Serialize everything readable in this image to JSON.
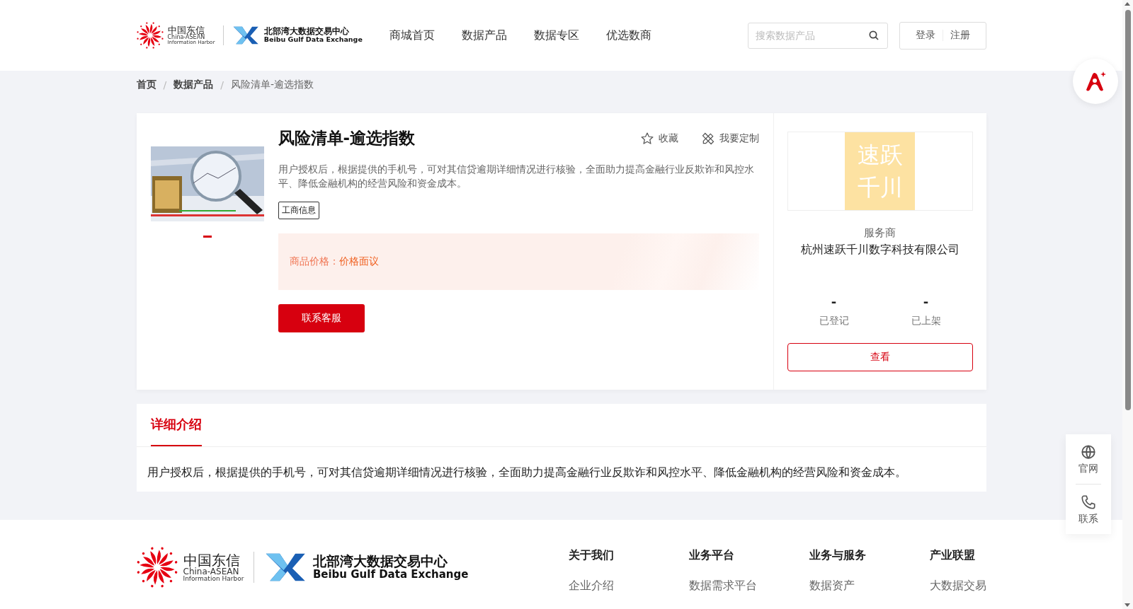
{
  "header": {
    "logo_a": {
      "name": "中国东信",
      "sub1": "China-ASEAN",
      "sub2": "Information Harbor"
    },
    "logo_b": {
      "name": "北部湾大数据交易中心",
      "sub": "Beibu Gulf Data Exchange"
    },
    "nav": [
      {
        "label": "商城首页",
        "selected": false
      },
      {
        "label": "数据产品",
        "selected": false
      },
      {
        "label": "数据专区",
        "selected": false
      },
      {
        "label": "优选数商",
        "selected": false
      }
    ],
    "search": {
      "placeholder": "搜索数据产品"
    },
    "auth": [
      "登录",
      "注册"
    ]
  },
  "breadcrumb": [
    {
      "label": "首页",
      "current": false
    },
    {
      "separator": "/",
      "label": "数据产品",
      "current": false
    },
    {
      "separator": "/",
      "label": "风险清单-逾选指数",
      "current": true
    }
  ],
  "product": {
    "carousel": [
      {
        "selected": true
      }
    ],
    "title": "风险清单-逾选指数",
    "actions": [
      {
        "kind": "favorite",
        "label": "收藏"
      },
      {
        "kind": "customize",
        "label": "我要定制"
      }
    ],
    "description": "用户授权后，根据提供的手机号，可对其信贷逾期详细情况进行核验，全面助力提高金融行业反欺诈和风控水平、降低金融机构的经营风险和资金成本。",
    "tags": [
      "工商信息"
    ],
    "price_label": "商品价格：",
    "price_value": "价格面议",
    "contact_button": "联系客服"
  },
  "provider": {
    "logo_lines": [
      "速跃",
      "千川"
    ],
    "role": "服务商",
    "name": "杭州速跃千川数字科技有限公司",
    "stats": [
      {
        "value": "-",
        "label": "已登记"
      },
      {
        "value": "-",
        "label": "已上架"
      }
    ],
    "view_button": "查看"
  },
  "detail": {
    "tabs": [
      {
        "label": "详细介绍",
        "selected": true
      }
    ],
    "text": "用户授权后，根据提供的手机号，可对其信贷逾期详细情况进行核验，全面助力提高金融行业反欺诈和风控水平、降低金融机构的经营风险和资金成本。"
  },
  "side_panel": [
    {
      "kind": "globe",
      "label": "官网"
    },
    {
      "kind": "phone",
      "label": "联系"
    }
  ],
  "footer": {
    "logo_a": {
      "name": "中国东信",
      "sub1": "China-ASEAN",
      "sub2": "Information Harbor"
    },
    "logo_b": {
      "name": "北部湾大数据交易中心",
      "sub": "Beibu Gulf Data Exchange"
    },
    "columns": [
      {
        "title": "关于我们",
        "links": [
          "企业介绍"
        ]
      },
      {
        "title": "业务平台",
        "links": [
          "数据需求平台"
        ]
      },
      {
        "title": "业务与服务",
        "links": [
          "数据资产"
        ]
      },
      {
        "title": "产业联盟",
        "links": [
          "大数据交易"
        ]
      }
    ]
  }
}
